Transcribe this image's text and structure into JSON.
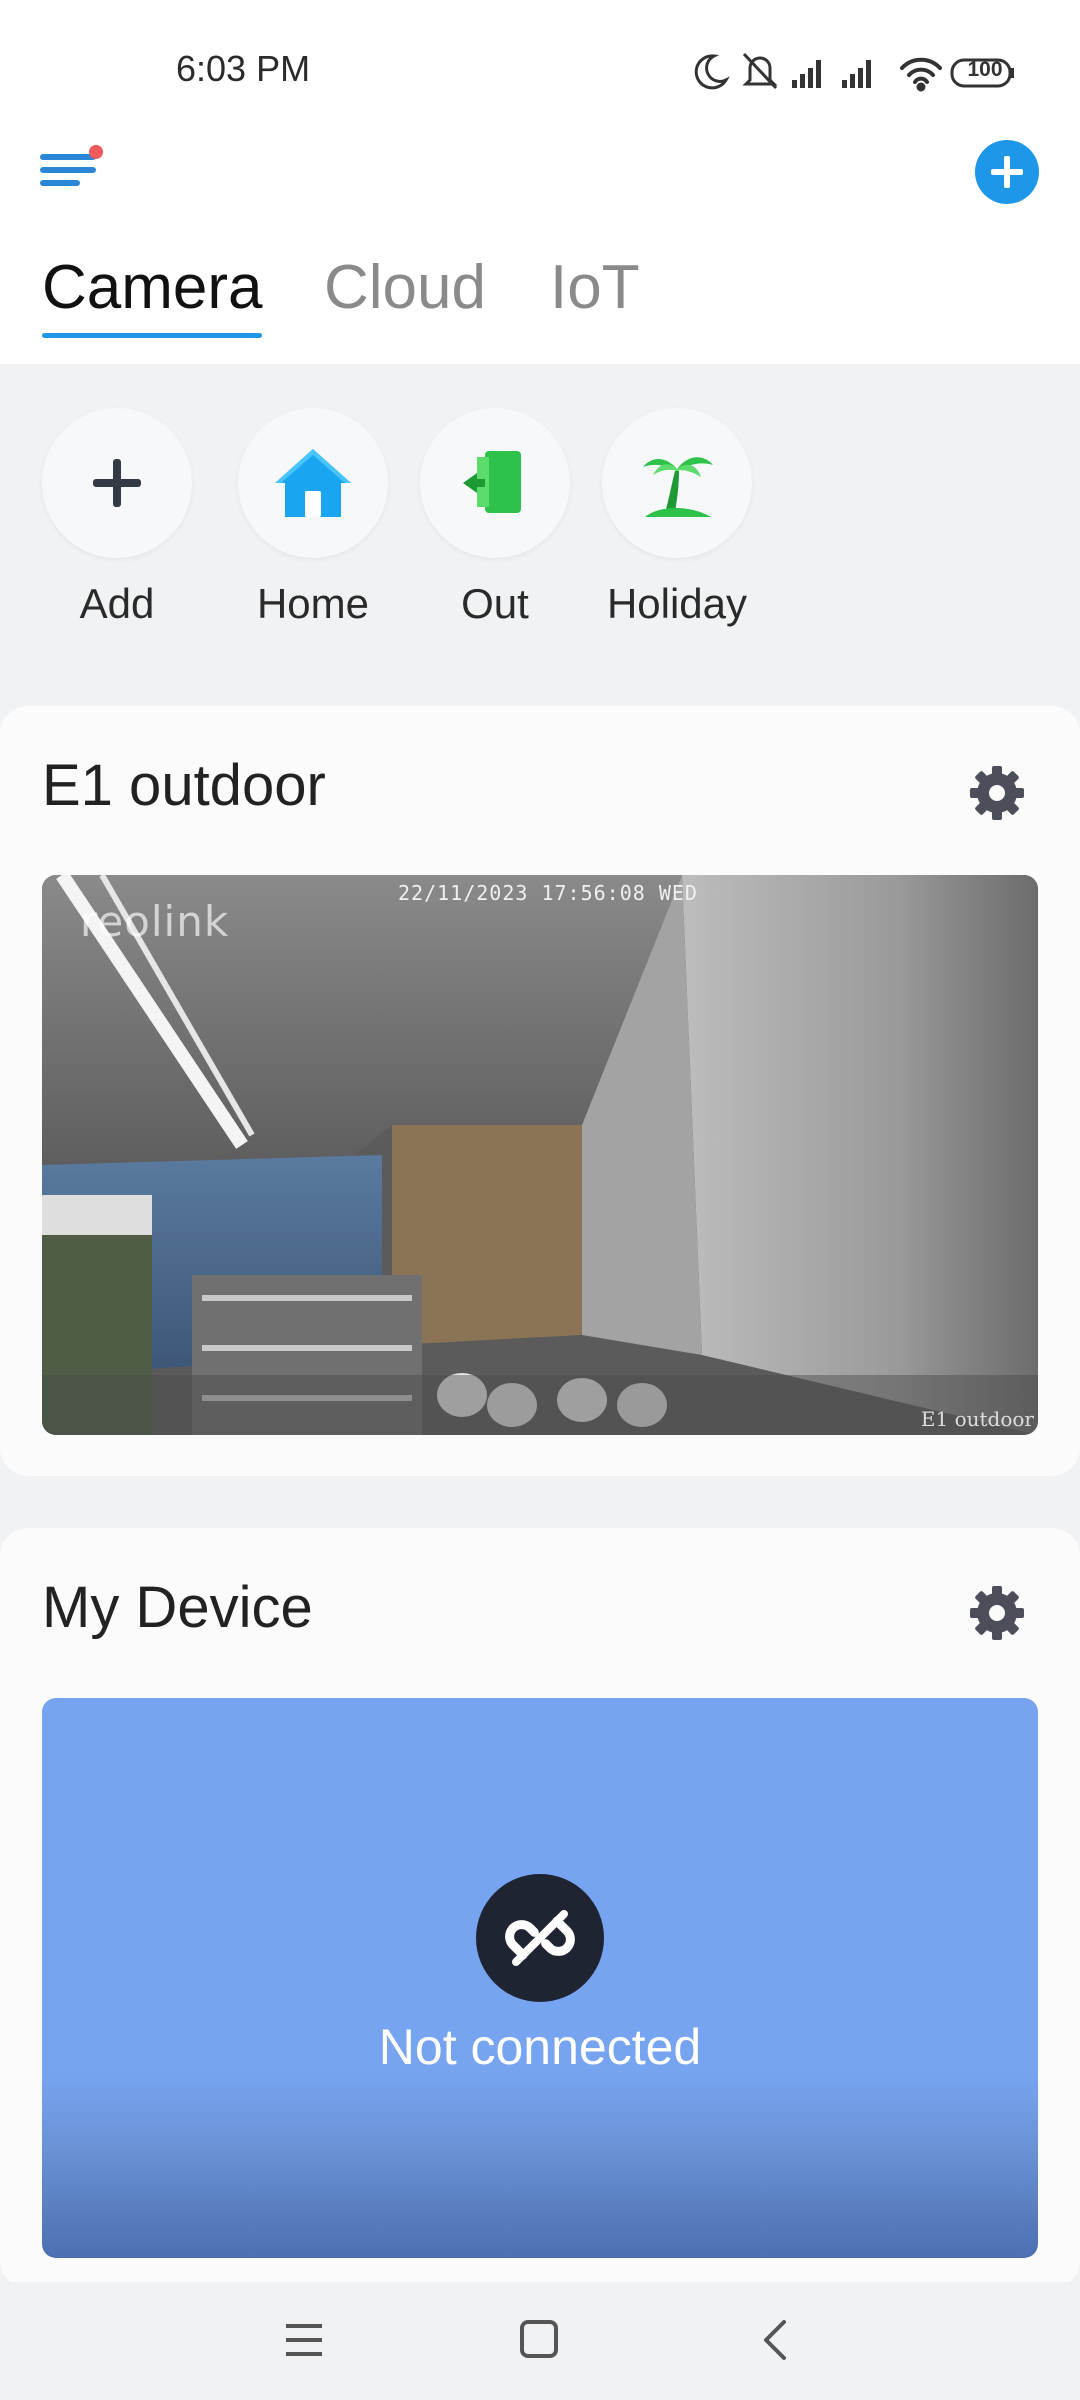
{
  "status_bar": {
    "time": "6:03 PM",
    "battery": "100"
  },
  "header": {
    "tabs": [
      {
        "label": "Camera",
        "active": true
      },
      {
        "label": "Cloud",
        "active": false
      },
      {
        "label": "IoT",
        "active": false
      }
    ]
  },
  "modes": [
    {
      "label": "Add",
      "icon": "plus-icon"
    },
    {
      "label": "Home",
      "icon": "home-icon"
    },
    {
      "label": "Out",
      "icon": "exit-door-icon"
    },
    {
      "label": "Holiday",
      "icon": "palm-tree-icon"
    }
  ],
  "cards": [
    {
      "title": "E1 outdoor",
      "feed": {
        "timestamp": "22/11/2023 17:56:08 WED",
        "watermark": "reolink",
        "camera_label": "E1 outdoor"
      }
    },
    {
      "title": "My Device",
      "status": "Not connected"
    }
  ],
  "colors": {
    "accent": "#1f97e8",
    "offline_panel": "#77a4f1",
    "home_icon": "#1aa5f0",
    "out_icon": "#2fc24a",
    "holiday_icon": "#2fc24a"
  }
}
